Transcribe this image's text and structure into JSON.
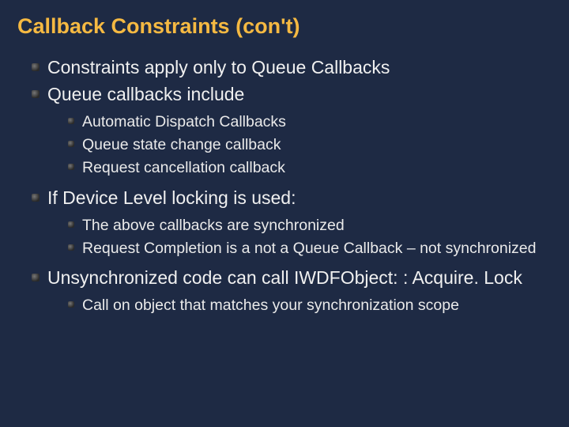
{
  "title": "Callback Constraints (con't)",
  "lvl1": {
    "i0": "Constraints apply only to Queue Callbacks",
    "i1": "Queue callbacks include",
    "i2": "If Device Level locking is used:",
    "i3": "Unsynchronized code can call IWDFObject: : Acquire. Lock"
  },
  "lvl2a": {
    "i0": "Automatic Dispatch Callbacks",
    "i1": "Queue state change callback",
    "i2": "Request cancellation callback"
  },
  "lvl2b": {
    "i0": "The above callbacks are synchronized",
    "i1": "Request Completion is a not a Queue Callback – not synchronized"
  },
  "lvl2c": {
    "i0": "Call on object that matches your synchronization scope"
  }
}
